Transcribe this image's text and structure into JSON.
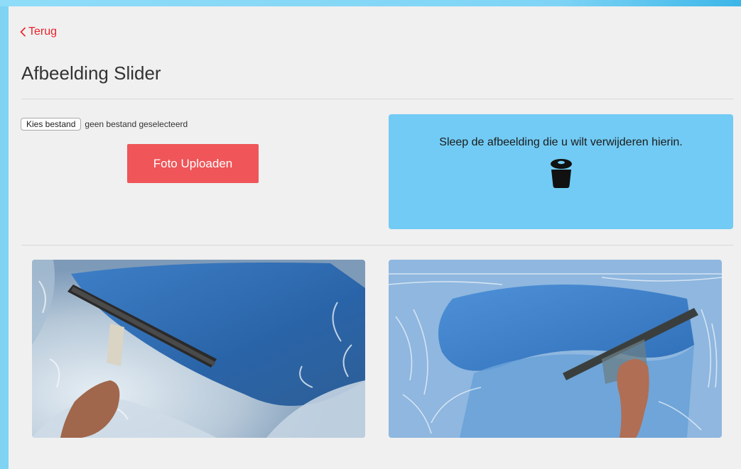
{
  "nav": {
    "back_label": "Terug"
  },
  "page": {
    "title": "Afbeelding Slider"
  },
  "upload": {
    "file_button_label": "Kies bestand",
    "file_status": "geen bestand geselecteerd",
    "upload_button_label": "Foto Uploaden"
  },
  "dropzone": {
    "instruction": "Sleep de afbeelding die u wilt verwijderen hierin.",
    "icon": "trash-icon"
  },
  "slides": [
    {
      "subject": "squeegee cleaning soapy window against blue sky"
    },
    {
      "subject": "squeegee cleaning soapy window against blue sky"
    }
  ],
  "colors": {
    "accent_red": "#e8222a",
    "upload_button": "#ef5559",
    "dropzone": "#72cbf4",
    "page_background": "#f0f0f0"
  }
}
